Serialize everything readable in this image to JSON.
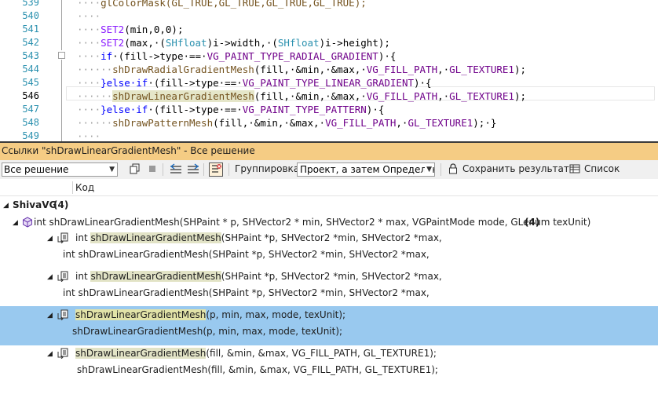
{
  "editor": {
    "lines": [
      {
        "num": "539",
        "current": false
      },
      {
        "num": "540",
        "current": false
      },
      {
        "num": "541",
        "current": false
      },
      {
        "num": "542",
        "current": false
      },
      {
        "num": "543",
        "current": false
      },
      {
        "num": "544",
        "current": false
      },
      {
        "num": "545",
        "current": false
      },
      {
        "num": "546",
        "current": true
      },
      {
        "num": "547",
        "current": false
      },
      {
        "num": "548",
        "current": false
      },
      {
        "num": "549",
        "current": false
      }
    ],
    "l539_text": "glColorMask(GL_TRUE,GL_TRUE,GL_TRUE,GL_TRUE);",
    "l541_macro": "SET2",
    "l541_rest": "(min,0,0);",
    "l542_macro": "SET2",
    "l542_a": "(max,·(",
    "l542_t1": "SHfloat",
    "l542_b": ")i->width,·(",
    "l542_t2": "SHfloat",
    "l542_c": ")i->height);",
    "l543_if": "if",
    "l543_a": "·(fill->type·==·",
    "l543_const": "VG_PAINT_TYPE_RADIAL_GRADIENT",
    "l543_b": ")·{",
    "l544_fn": "shDrawRadialGradientMesh",
    "l544_a": "(fill,·&min,·&max,·",
    "l544_c1": "VG_FILL_PATH",
    "l544_c2": "GL_TEXTURE1",
    "l544_end": ");",
    "l545_else": "}else·if",
    "l545_a": "·(fill->type·==·",
    "l545_const": "VG_PAINT_TYPE_LINEAR_GRADIENT",
    "l545_b": ")·{",
    "l546_fn": "shDrawLinearGradientMesh",
    "l546_a": "(fill,·&min,·&max,·",
    "l546_c1": "VG_FILL_PATH",
    "l546_c2": "GL_TEXTURE1",
    "l546_end": ");",
    "l547_else": "}else·if",
    "l547_a": "·(fill->type·==·",
    "l547_const": "VG_PAINT_TYPE_PATTERN",
    "l547_b": ")·{",
    "l548_fn": "shDrawPatternMesh",
    "l548_a": "(fill,·&min,·&max,·",
    "l548_c1": "VG_FILL_PATH",
    "l548_c2": "GL_TEXTURE1",
    "l548_end": ");·}",
    "comma_sep": ",·"
  },
  "panel": {
    "title": "Ссылки \"shDrawLinearGradientMesh\" - Все решение"
  },
  "toolbar": {
    "scope_value": "Все решение",
    "grouping_label": "Группировка:",
    "grouping_value": "Проект, а затем Определени",
    "save_results_label": "Сохранить результаты",
    "list_label": "Список"
  },
  "columns": {
    "code_header": "Код"
  },
  "tree": {
    "project_name": "ShivaVG",
    "project_count": "(4)",
    "definition": "int shDrawLinearGradientMesh(SHPaint * p, SHVector2 * min, SHVector2 * max, VGPaintMode mode, GLenum texUnit)",
    "definition_count": "(4)",
    "references": [
      {
        "pre": "int ",
        "match": "shDrawLinearGradientMesh",
        "post": "(SHPaint *p, SHVector2 *min, SHVector2 *max,",
        "preview": "int shDrawLinearGradientMesh(SHPaint *p, SHVector2 *min, SHVector2 *max,"
      },
      {
        "pre": "int ",
        "match": "shDrawLinearGradientMesh",
        "post": "(SHPaint *p, SHVector2 *min, SHVector2 *max,",
        "preview": "int shDrawLinearGradientMesh(SHPaint *p, SHVector2 *min, SHVector2 *max,"
      },
      {
        "pre": "",
        "match": "shDrawLinearGradientMesh",
        "post": "(p, min, max, mode, texUnit);",
        "preview": "shDrawLinearGradientMesh(p, min, max, mode, texUnit);"
      },
      {
        "pre": "",
        "match": "shDrawLinearGradientMesh",
        "post": "(fill, &min, &max, VG_FILL_PATH, GL_TEXTURE1);",
        "preview": "shDrawLinearGradientMesh(fill, &min, &max, VG_FILL_PATH, GL_TEXTURE1);"
      }
    ]
  },
  "colors": {
    "panel_title_bg": "#f5cc84",
    "selected_row_bg": "#99c9ef",
    "match_highlight": "#e2e3c6"
  }
}
